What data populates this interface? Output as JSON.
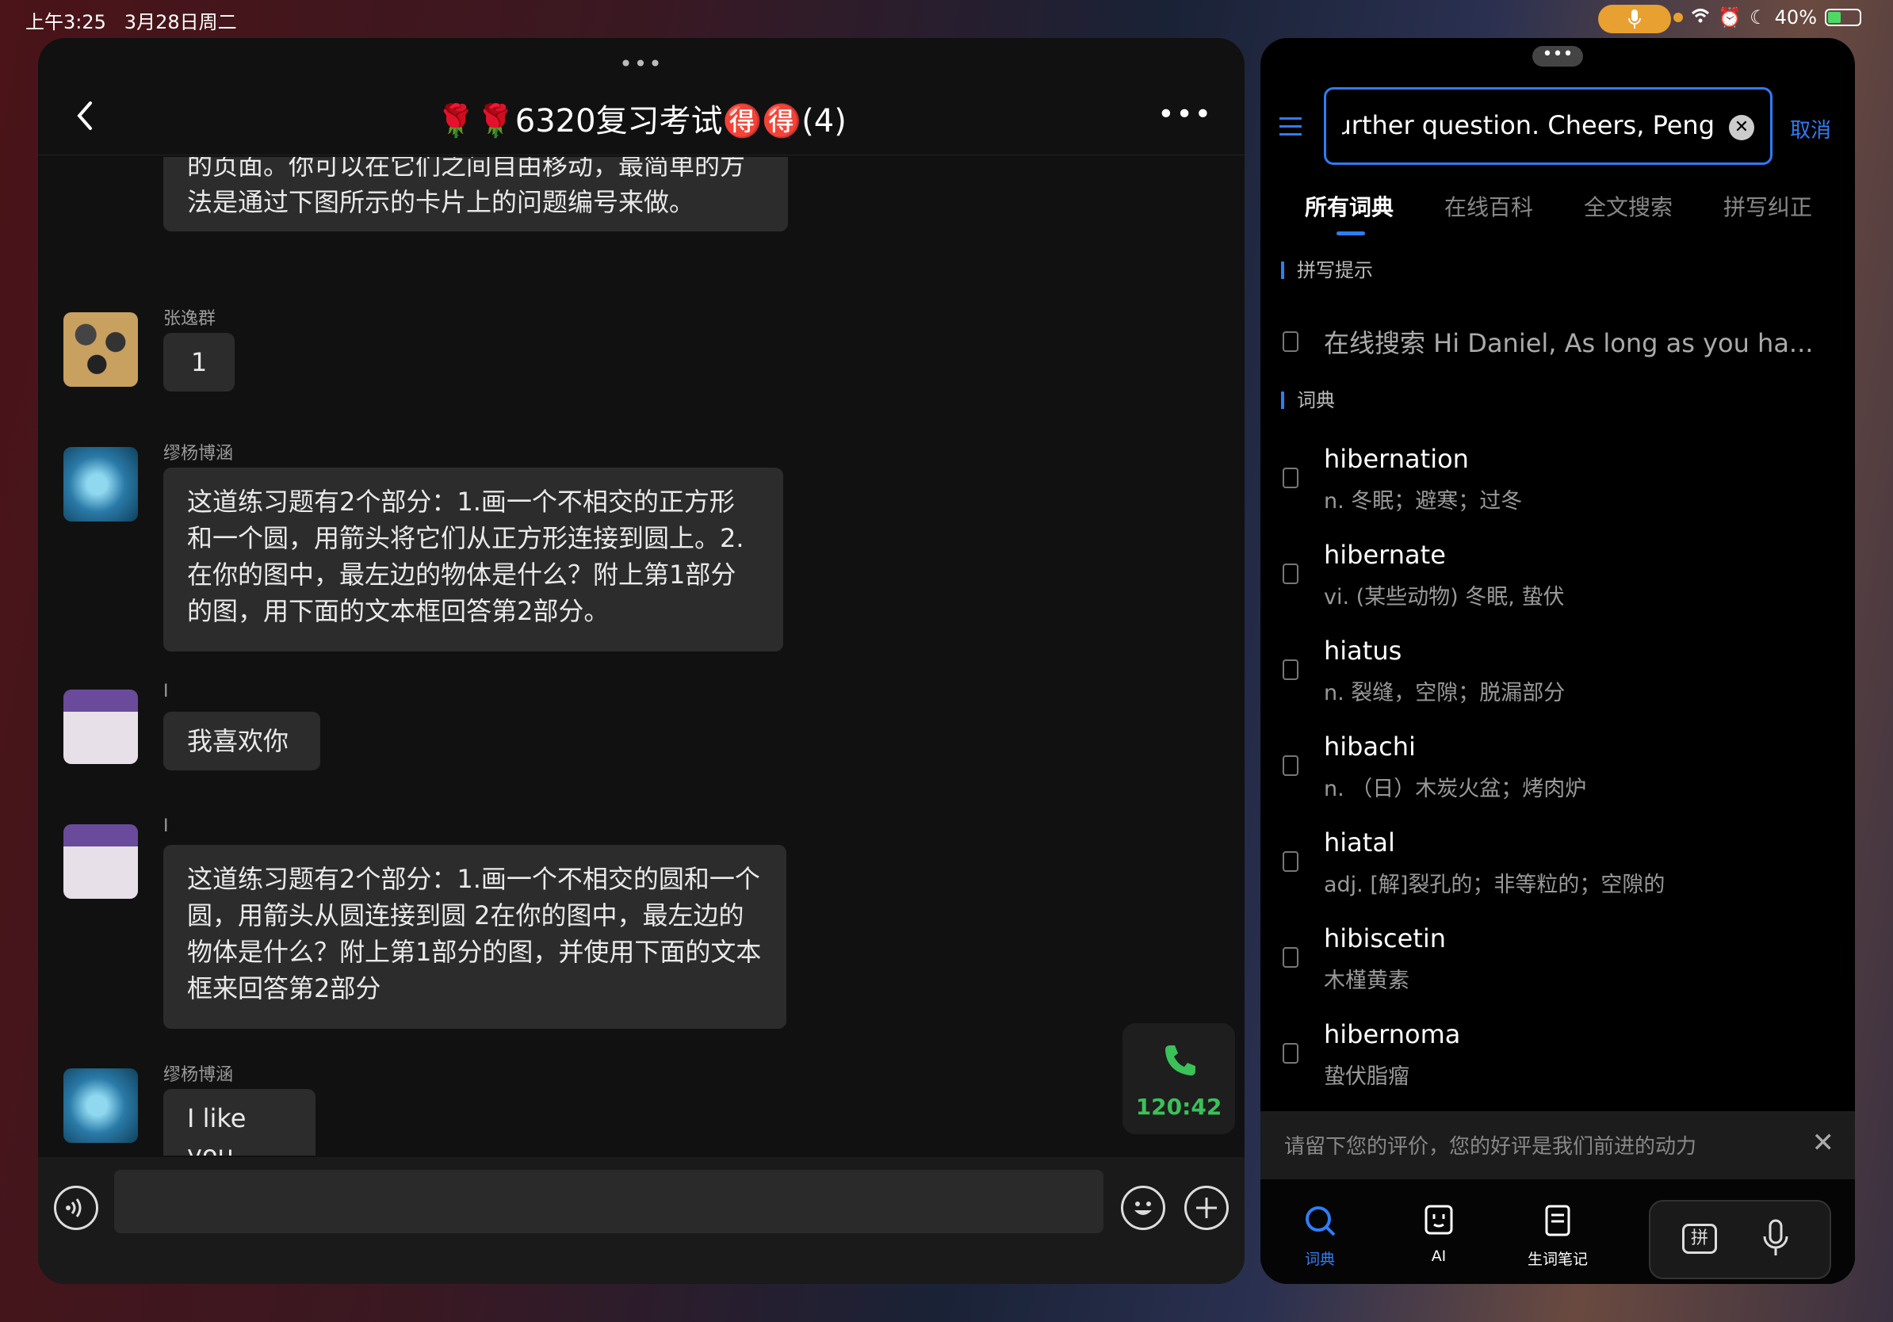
{
  "status": {
    "time": "上午3:25",
    "date": "3月28日周二",
    "battery": "40%"
  },
  "chat": {
    "title": "🌹🌹6320复习考试🉐🉐(4)",
    "messages": [
      {
        "sender": "",
        "text": "的页面。你可以在它们之间自由移动，最简单的方法是通过下图所示的卡片上的问题编号来做。",
        "avatar": "none"
      },
      {
        "sender": "张逸群",
        "text": "1",
        "avatar": "stones"
      },
      {
        "sender": "缪杨博涵",
        "text": "这道练习题有2个部分：1.画一个不相交的正方形和一个圆，用箭头将它们从正方形连接到圆上。2.在你的图中，最左边的物体是什么？附上第1部分的图，用下面的文本框回答第2部分。",
        "avatar": "whale"
      },
      {
        "sender": "I",
        "text": "我喜欢你",
        "avatar": "girl"
      },
      {
        "sender": "I",
        "text": "这道练习题有2个部分：1.画一个不相交的圆和一个圆，用箭头从圆连接到圆 2在你的图中，最左边的物体是什么？附上第1部分的图，并使用下面的文本框来回答第2部分",
        "avatar": "girl"
      },
      {
        "sender": "缪杨博涵",
        "text": "I like you",
        "avatar": "whale"
      }
    ],
    "call_duration": "120:42"
  },
  "dict": {
    "search_value": "urther question. Cheers, Peng",
    "cancel_label": "取消",
    "tabs": [
      "所有词典",
      "在线百科",
      "全文搜索",
      "拼写纠正"
    ],
    "spell_section": "拼写提示",
    "online_hint": "在线搜索 Hi Daniel, As long as you ha...",
    "dict_section": "词典",
    "entries": [
      {
        "word": "hibernation",
        "def": "n. 冬眠；避寒；过冬"
      },
      {
        "word": "hibernate",
        "def": "vi. (某些动物) 冬眠, 蛰伏"
      },
      {
        "word": "hiatus",
        "def": "n. 裂缝，空隙；脱漏部分"
      },
      {
        "word": "hibachi",
        "def": "n. （日）木炭火盆；烤肉炉"
      },
      {
        "word": "hiatal",
        "def": "adj. [解]裂孔的；非等粒的；空隙的"
      },
      {
        "word": "hibiscetin",
        "def": "木槿黄素"
      },
      {
        "word": "hibernoma",
        "def": "蛰伏脂瘤"
      }
    ],
    "feedback": "请留下您的评价，您的好评是我们前进的动力",
    "nav": [
      "词典",
      "AI",
      "生词笔记"
    ],
    "pinyin_key": "拼"
  },
  "colors": {
    "accent": "#2f7cf6",
    "call_green": "#3cc05a"
  }
}
